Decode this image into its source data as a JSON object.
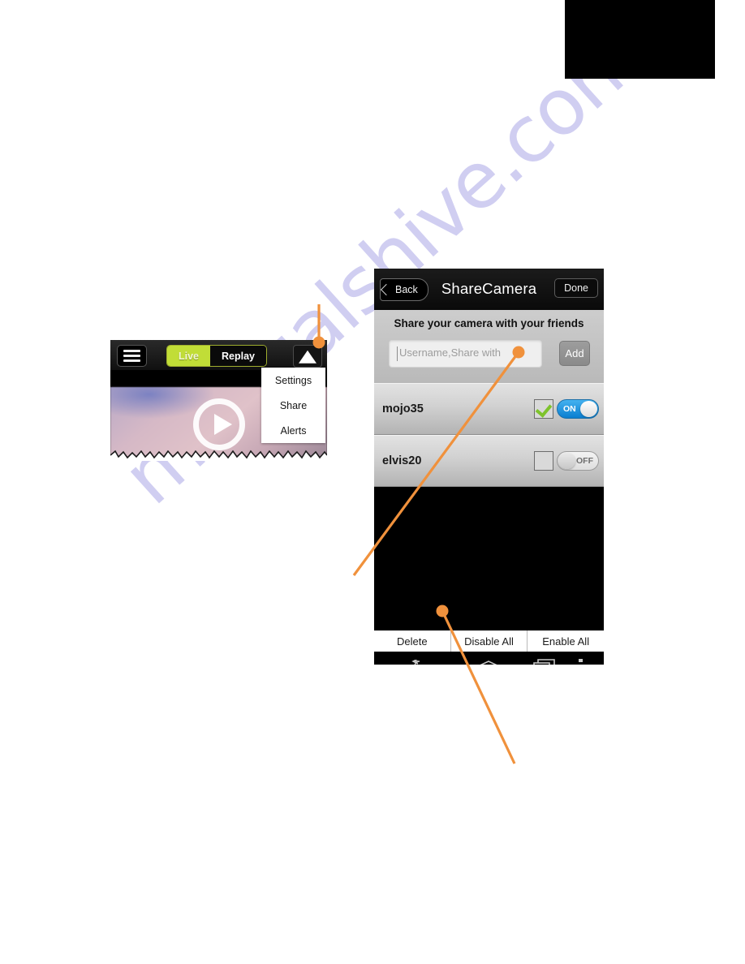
{
  "page": {
    "watermark_text": "manualshive.com",
    "watermark_color": "#c8c6ef",
    "background_color": "#ffffff",
    "accent_callout_color": "#f0913c"
  },
  "camera_widget": {
    "menu_icon": "hamburger-icon",
    "segmented": {
      "live_label": "Live",
      "replay_label": "Replay",
      "selected": "Live",
      "active_color": "#c1dd37"
    },
    "triangle_icon": "triangle-up-icon",
    "dropdown": {
      "items": [
        {
          "label": "Settings"
        },
        {
          "label": "Share"
        },
        {
          "label": "Alerts"
        }
      ]
    },
    "video": {
      "play_icon": "play-icon"
    }
  },
  "phone": {
    "header": {
      "back_label": "Back",
      "title": "ShareCamera",
      "done_label": "Done"
    },
    "share_panel": {
      "heading": "Share your camera with your friends",
      "input_placeholder": "Username,Share with",
      "input_value": "",
      "add_label": "Add"
    },
    "rows": [
      {
        "name": "mojo35",
        "checked": true,
        "toggle_label": "ON",
        "toggle_state": "on",
        "toggle_color": "#2196e8"
      },
      {
        "name": "elvis20",
        "checked": false,
        "toggle_label": "OFF",
        "toggle_state": "off",
        "toggle_color": "#dedede"
      }
    ],
    "action_bar": {
      "buttons": [
        {
          "label": "Delete"
        },
        {
          "label": "Disable All"
        },
        {
          "label": "Enable All"
        }
      ]
    },
    "nav_bar": {
      "back_icon": "nav-back-icon",
      "home_icon": "nav-home-icon",
      "recents_icon": "nav-recents-icon",
      "overflow_icon": "nav-overflow-menu-icon"
    }
  },
  "callouts": [
    {
      "name": "callout-to-triangle-button"
    },
    {
      "name": "callout-to-username-input"
    },
    {
      "name": "callout-to-action-bar"
    }
  ]
}
